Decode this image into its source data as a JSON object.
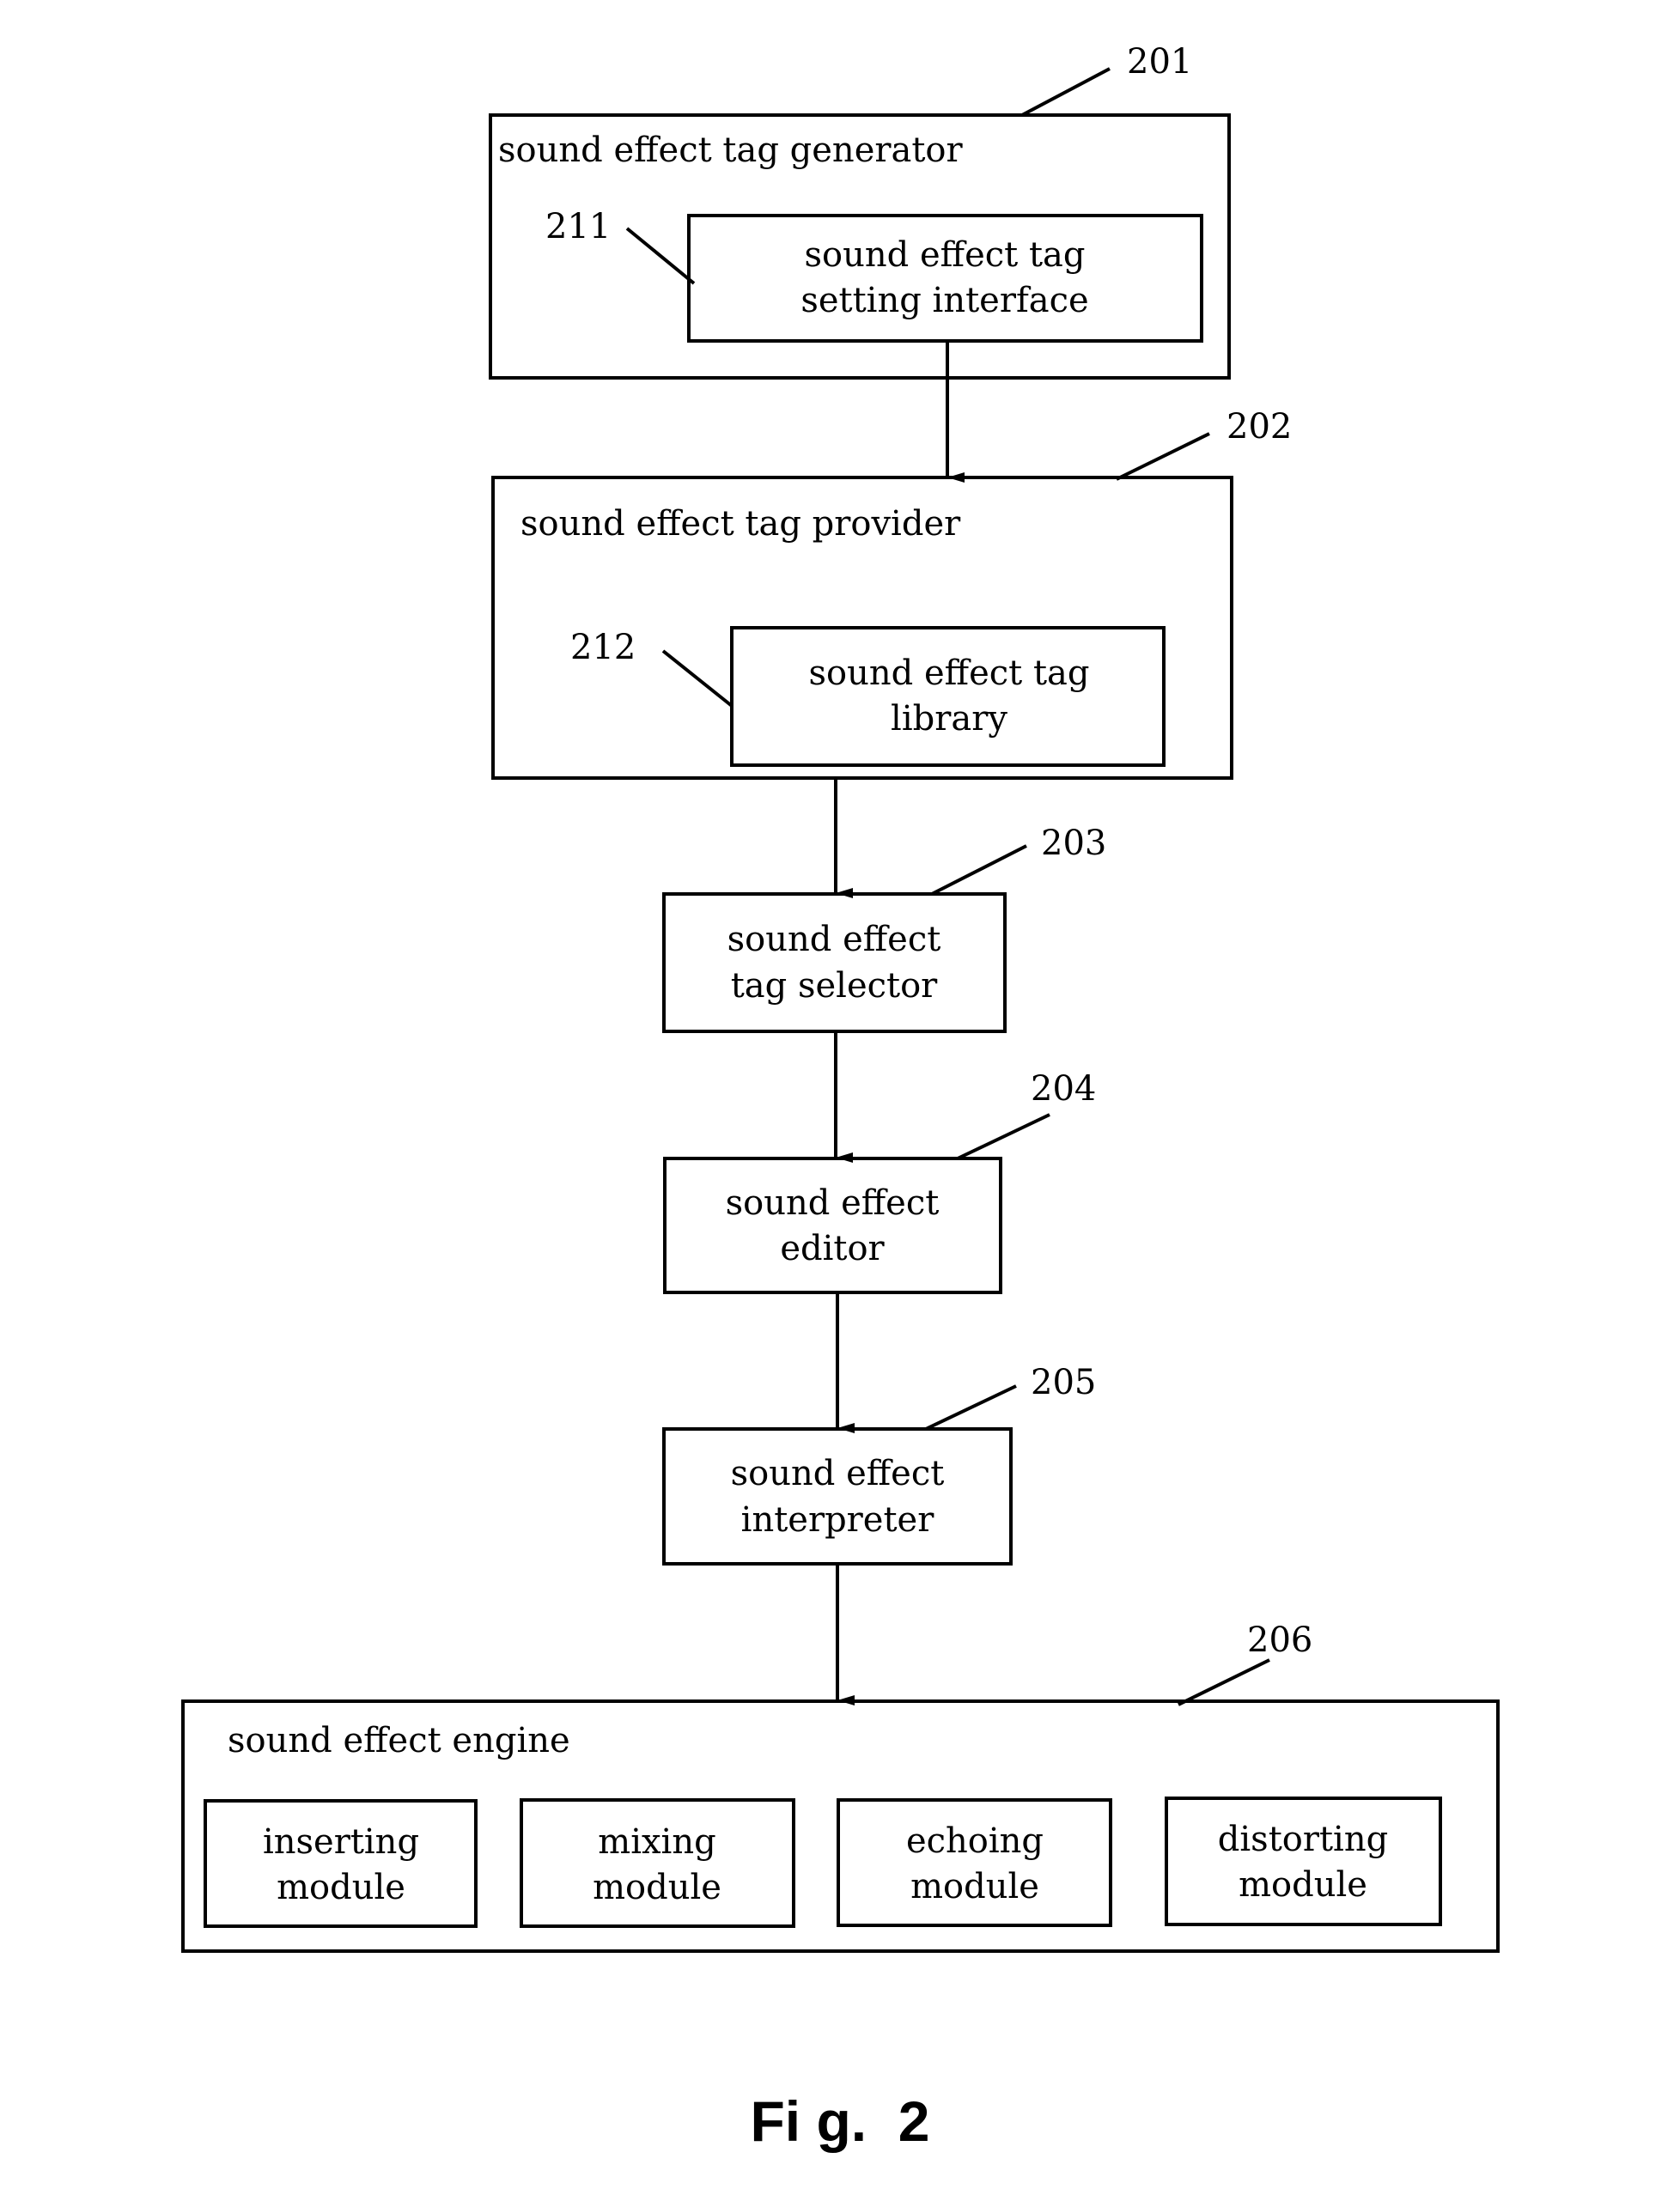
{
  "figure_caption": "Fi g.  2",
  "blocks": {
    "b201": {
      "ref": "201",
      "label": "sound effect tag generator"
    },
    "b211": {
      "ref": "211",
      "line1": "sound effect tag",
      "line2": "setting interface"
    },
    "b202": {
      "ref": "202",
      "label": "sound effect tag provider"
    },
    "b212": {
      "ref": "212",
      "line1": "sound effect tag",
      "line2": "library"
    },
    "b203": {
      "ref": "203",
      "line1": "sound effect",
      "line2": "tag selector"
    },
    "b204": {
      "ref": "204",
      "line1": "sound effect",
      "line2": "editor"
    },
    "b205": {
      "ref": "205",
      "line1": "sound effect",
      "line2": "interpreter"
    },
    "b206": {
      "ref": "206",
      "label": "sound effect engine"
    }
  },
  "modules": [
    {
      "line1": "inserting",
      "line2": "module"
    },
    {
      "line1": "mixing",
      "line2": "module"
    },
    {
      "line1": "echoing",
      "line2": "module"
    },
    {
      "line1": "distorting",
      "line2": "module"
    }
  ]
}
